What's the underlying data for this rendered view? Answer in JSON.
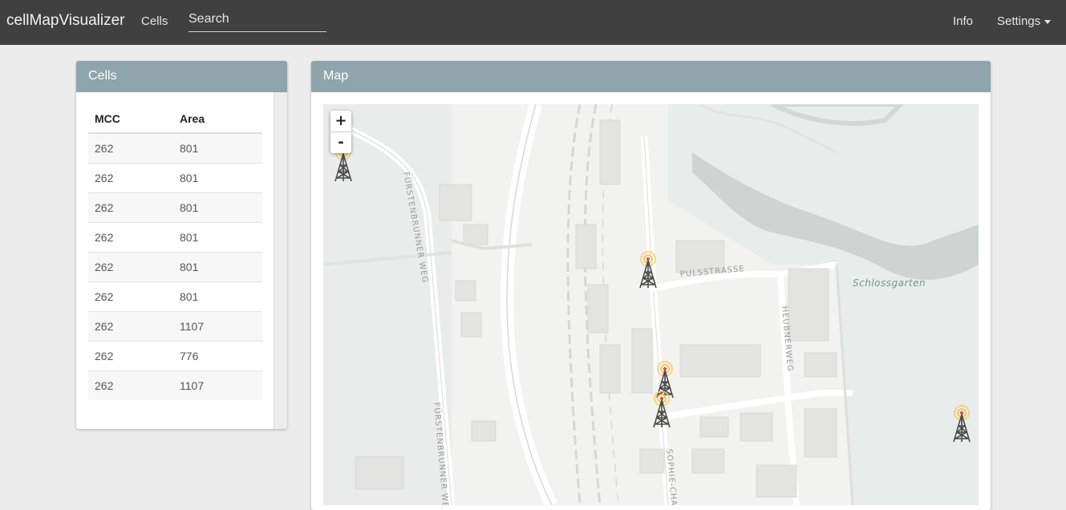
{
  "navbar": {
    "brand": "cellMapVisualizer",
    "cells_link": "Cells",
    "search_placeholder": "Search",
    "info_link": "Info",
    "settings_link": "Settings"
  },
  "cells_panel": {
    "title": "Cells",
    "columns": [
      "MCC",
      "Area"
    ],
    "rows": [
      {
        "mcc": "262",
        "area": "801"
      },
      {
        "mcc": "262",
        "area": "801"
      },
      {
        "mcc": "262",
        "area": "801"
      },
      {
        "mcc": "262",
        "area": "801"
      },
      {
        "mcc": "262",
        "area": "801"
      },
      {
        "mcc": "262",
        "area": "801"
      },
      {
        "mcc": "262",
        "area": "1107"
      },
      {
        "mcc": "262",
        "area": "776"
      },
      {
        "mcc": "262",
        "area": "1107"
      }
    ]
  },
  "map_panel": {
    "title": "Map",
    "zoom_in": "+",
    "zoom_out": "-",
    "labels": {
      "street_1": "PULSSTRASSE",
      "street_2": "FÜRSTENBRUNNER WEG",
      "street_3": "FÜRSTENBRUNNER WEG",
      "street_4": "HEUBNERWEG",
      "street_5": "SOPHIE-CHA",
      "park": "Schlossgarten"
    },
    "towers_count": 5
  },
  "colors": {
    "navbar_bg": "#404040",
    "panel_heading": "#90a4ad",
    "tower_glow": "#f5c85a"
  }
}
